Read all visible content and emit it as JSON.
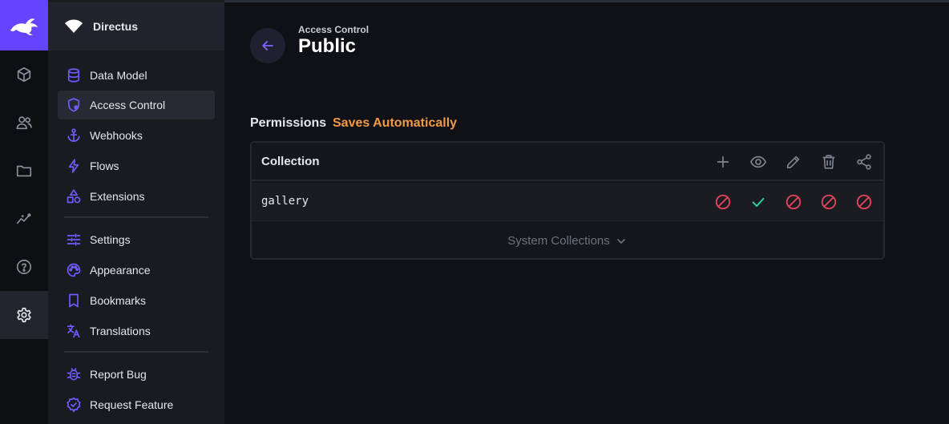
{
  "project": {
    "name": "Directus"
  },
  "module_bar": {
    "items": [
      {
        "icon": "box-icon",
        "name": "content"
      },
      {
        "icon": "users-icon",
        "name": "user-directory"
      },
      {
        "icon": "folder-icon",
        "name": "file-library"
      },
      {
        "icon": "insights-icon",
        "name": "insights"
      },
      {
        "icon": "help-icon",
        "name": "documentation"
      },
      {
        "icon": "settings-icon",
        "name": "settings",
        "active": true
      }
    ]
  },
  "nav": {
    "items": [
      {
        "label": "Data Model",
        "icon": "database-icon"
      },
      {
        "label": "Access Control",
        "icon": "shield-icon",
        "active": true
      },
      {
        "label": "Webhooks",
        "icon": "anchor-icon"
      },
      {
        "label": "Flows",
        "icon": "bolt-icon"
      },
      {
        "label": "Extensions",
        "icon": "shapes-icon"
      },
      {
        "label": "Settings",
        "icon": "sliders-icon"
      },
      {
        "label": "Appearance",
        "icon": "palette-icon"
      },
      {
        "label": "Bookmarks",
        "icon": "bookmark-icon"
      },
      {
        "label": "Translations",
        "icon": "translate-icon"
      },
      {
        "label": "Report Bug",
        "icon": "bug-icon"
      },
      {
        "label": "Request Feature",
        "icon": "verified-icon"
      }
    ]
  },
  "header": {
    "breadcrumb": "Access Control",
    "title": "Public"
  },
  "permissions": {
    "label": "Permissions",
    "status": "Saves Automatically",
    "column_header": "Collection",
    "actions": [
      "create",
      "read",
      "update",
      "delete",
      "share"
    ],
    "rows": [
      {
        "collection": "gallery",
        "values": [
          "none",
          "all",
          "none",
          "none",
          "none"
        ]
      }
    ],
    "system_collections_label": "System Collections"
  },
  "colors": {
    "accent": "#6644ff",
    "warning": "#f19a43",
    "danger": "#e5435d",
    "success": "#2ecda7"
  }
}
